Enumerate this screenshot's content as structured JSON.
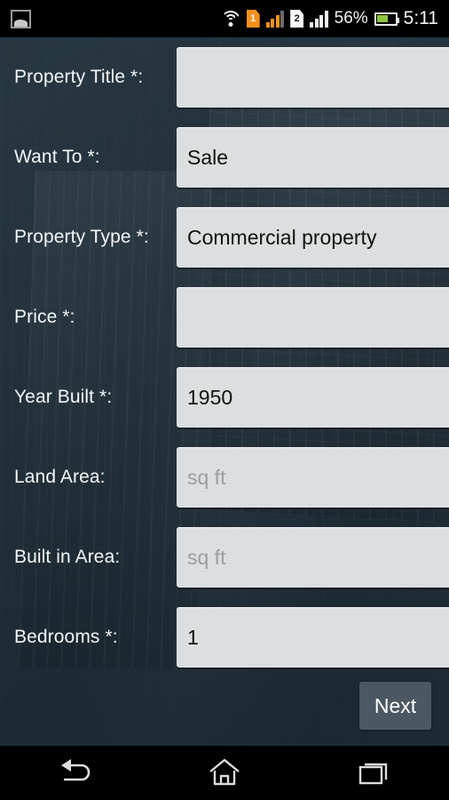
{
  "status_bar": {
    "notification_icon": "gallery-icon",
    "wifi_icon": "wifi-icon",
    "sim1_label": "1",
    "sim1_color": "#f5911e",
    "sim2_label": "2",
    "sim2_color": "#fafafa",
    "battery_percent": "56%",
    "battery_fill_color": "#8ec63f",
    "clock": "5:11"
  },
  "theme": {
    "background": "#263540",
    "input_background": "#dcdfe0",
    "label_color": "#f4f6f7",
    "button_background": "#4b5862"
  },
  "form": {
    "fields": [
      {
        "label": "Property Title *:",
        "value": "",
        "placeholder": "",
        "required": true
      },
      {
        "label": "Want To *:",
        "value": "Sale",
        "placeholder": "",
        "required": true
      },
      {
        "label": "Property Type *:",
        "value": "Commercial property",
        "placeholder": "",
        "required": true
      },
      {
        "label": "Price *:",
        "value": "",
        "placeholder": "",
        "required": true
      },
      {
        "label": "Year Built *:",
        "value": "1950",
        "placeholder": "",
        "required": true
      },
      {
        "label": "Land Area:",
        "value": "",
        "placeholder": "sq ft",
        "required": false
      },
      {
        "label": "Built in Area:",
        "value": "",
        "placeholder": "sq ft",
        "required": false
      },
      {
        "label": "Bedrooms *:",
        "value": "1",
        "placeholder": "",
        "required": true
      }
    ],
    "next_button_label": "Next"
  },
  "nav_bar": {
    "back_icon": "back-arrow-icon",
    "home_icon": "home-icon",
    "recents_icon": "recent-apps-icon"
  }
}
